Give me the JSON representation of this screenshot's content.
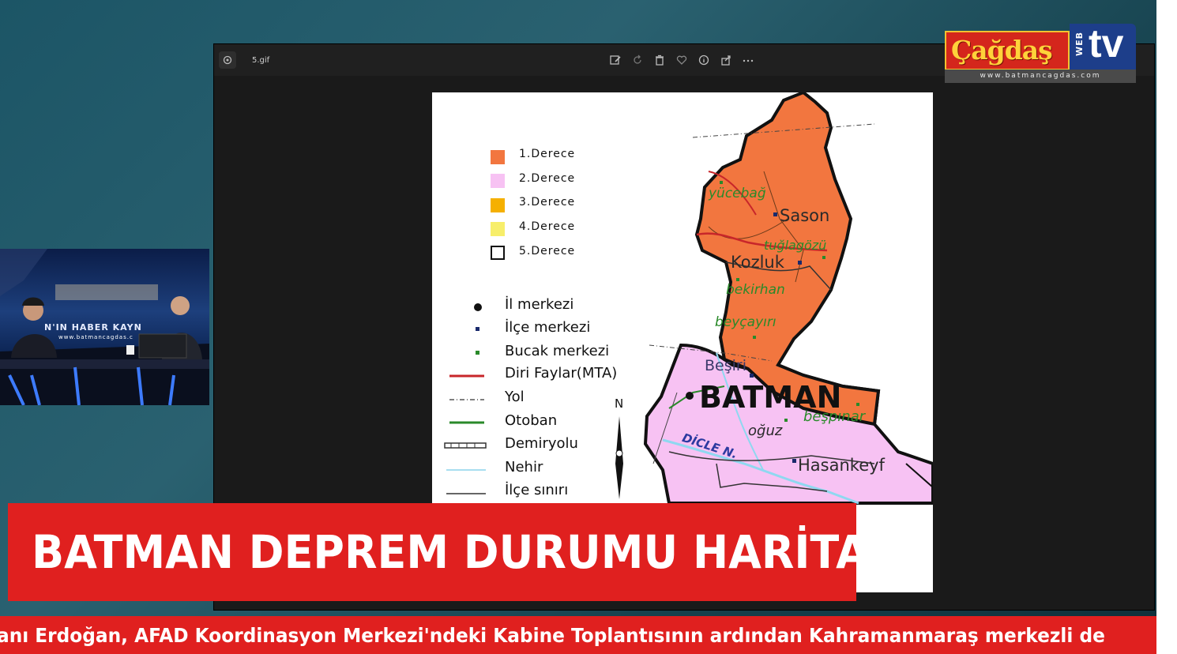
{
  "viewer": {
    "file_name": "5.gif",
    "toolbar_icons": [
      "edit-icon",
      "rotate-icon",
      "delete-icon",
      "favorite-icon",
      "info-icon",
      "share-icon",
      "more-icon"
    ]
  },
  "logo": {
    "wordmark": "Çağdaş",
    "web": "WEB",
    "tv": "tv",
    "url": "www.batmancagdas.com"
  },
  "studio": {
    "backdrop_text": "N'IN HABER KAYN",
    "backdrop_url": "www.batmancagdas.c"
  },
  "map": {
    "legend": {
      "grades": [
        {
          "label": "1.Derece",
          "color": "#f2763f"
        },
        {
          "label": "2.Derece",
          "color": "#f7c2f3"
        },
        {
          "label": "3.Derece",
          "color": "#f5b000"
        },
        {
          "label": "4.Derece",
          "color": "#f7ee6a"
        },
        {
          "label": "5.Derece",
          "color": "#ffffff"
        }
      ],
      "symbols": [
        {
          "label": "İl merkezi",
          "symbol": "city-dot"
        },
        {
          "label": "İlçe merkezi",
          "symbol": "district-square"
        },
        {
          "label": "Bucak merkezi",
          "symbol": "subdistrict-square"
        },
        {
          "label": "Diri Faylar(MTA)",
          "symbol": "red-line"
        },
        {
          "label": "Yol",
          "symbol": "dash-dot-line"
        },
        {
          "label": "Otoban",
          "symbol": "green-line"
        },
        {
          "label": "Demiryolu",
          "symbol": "rail-line"
        },
        {
          "label": "Nehir",
          "symbol": "blue-line"
        },
        {
          "label": "İlçe sınırı",
          "symbol": "thin-black-line"
        }
      ]
    },
    "north": "N",
    "places": {
      "sason": "Sason",
      "kozluk": "Kozluk",
      "besiri": "Beşiri",
      "batman": "BATMAN",
      "hasankeyf": "Hasankeyf",
      "yucebag": "yücebağ",
      "tuglagozu": "tuğlagözü",
      "bekirhan": "bekirhan",
      "beycayiri": "beyçayırı",
      "bespinar": "beşpınar",
      "oguz": "oğuz",
      "dicle": "DİCLE N."
    }
  },
  "banner": {
    "title": "BATMAN DEPREM DURUMU HARİTASI"
  },
  "ticker": {
    "text": "anı Erdoğan, AFAD Koordinasyon Merkezi'ndeki Kabine Toplantısının ardından Kahramanmaraş merkezli de"
  }
}
